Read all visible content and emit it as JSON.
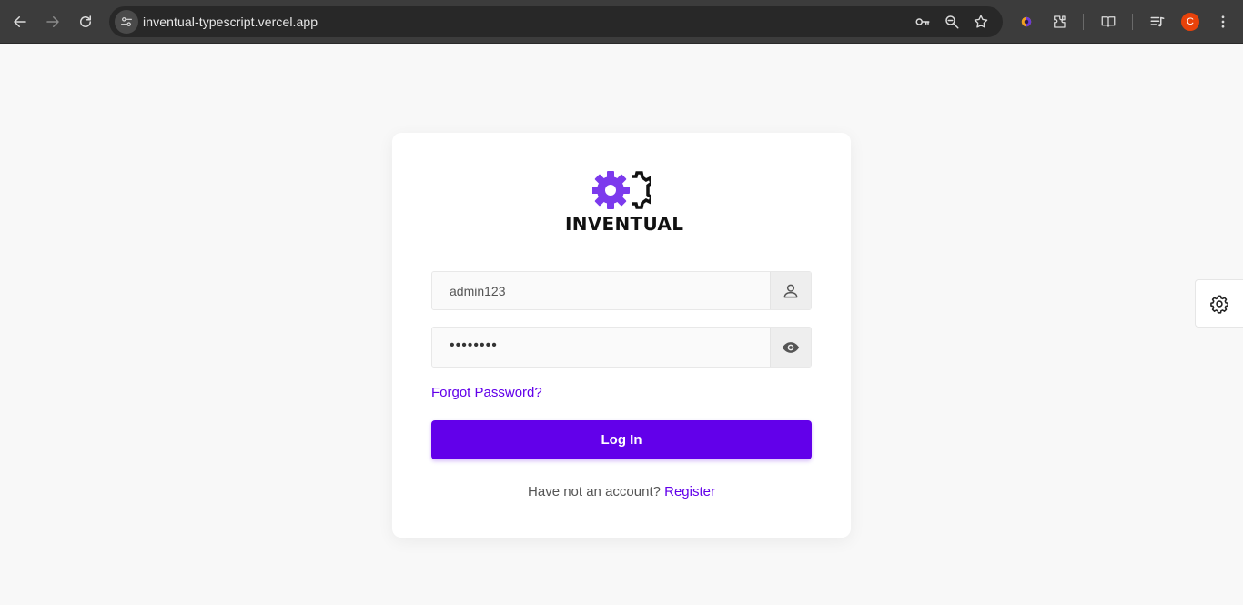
{
  "browser": {
    "url": "inventual-typescript.vercel.app",
    "profile_initial": "C",
    "icons": [
      "back-icon",
      "forward-icon",
      "reload-icon",
      "site-info-icon",
      "key-icon",
      "zoom-icon",
      "star-icon",
      "extension-icon",
      "puzzle-icon",
      "reading-list-icon",
      "media-icon",
      "menu-icon"
    ]
  },
  "login": {
    "brand": "INVENTUAL",
    "username_value": "admin123",
    "password_mask": "••••••••",
    "forgot_label": "Forgot Password?",
    "login_label": "Log In",
    "register_prompt": "Have not an account?",
    "register_label": "Register"
  },
  "colors": {
    "accent": "#6200ea",
    "logo_purple": "#7c3aed",
    "page_bg": "#f8f8f8"
  }
}
